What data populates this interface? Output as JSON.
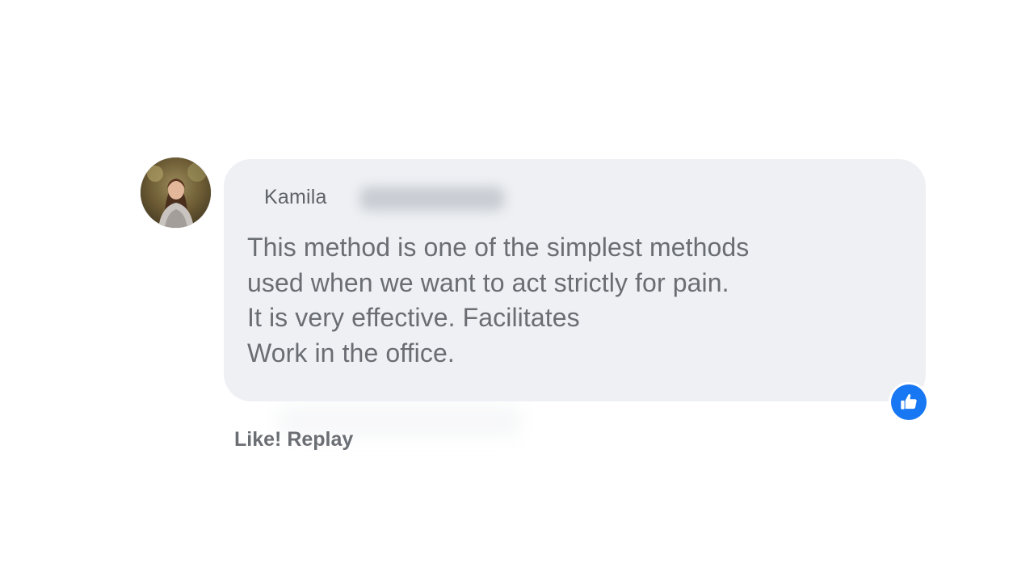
{
  "comment": {
    "author_first_name": "Kamila",
    "lines": [
      "This method is one of the simplest methods",
      "used when we want to act strictly for pain.",
      "It is very effective. Facilitates",
      "Work in the office."
    ],
    "reaction_icon": "thumbs-up-icon",
    "reaction_color": "#1877f2",
    "bubble_color": "#eef0f3"
  },
  "actions": {
    "like_label": "Like!",
    "reply_label": "Replay"
  }
}
